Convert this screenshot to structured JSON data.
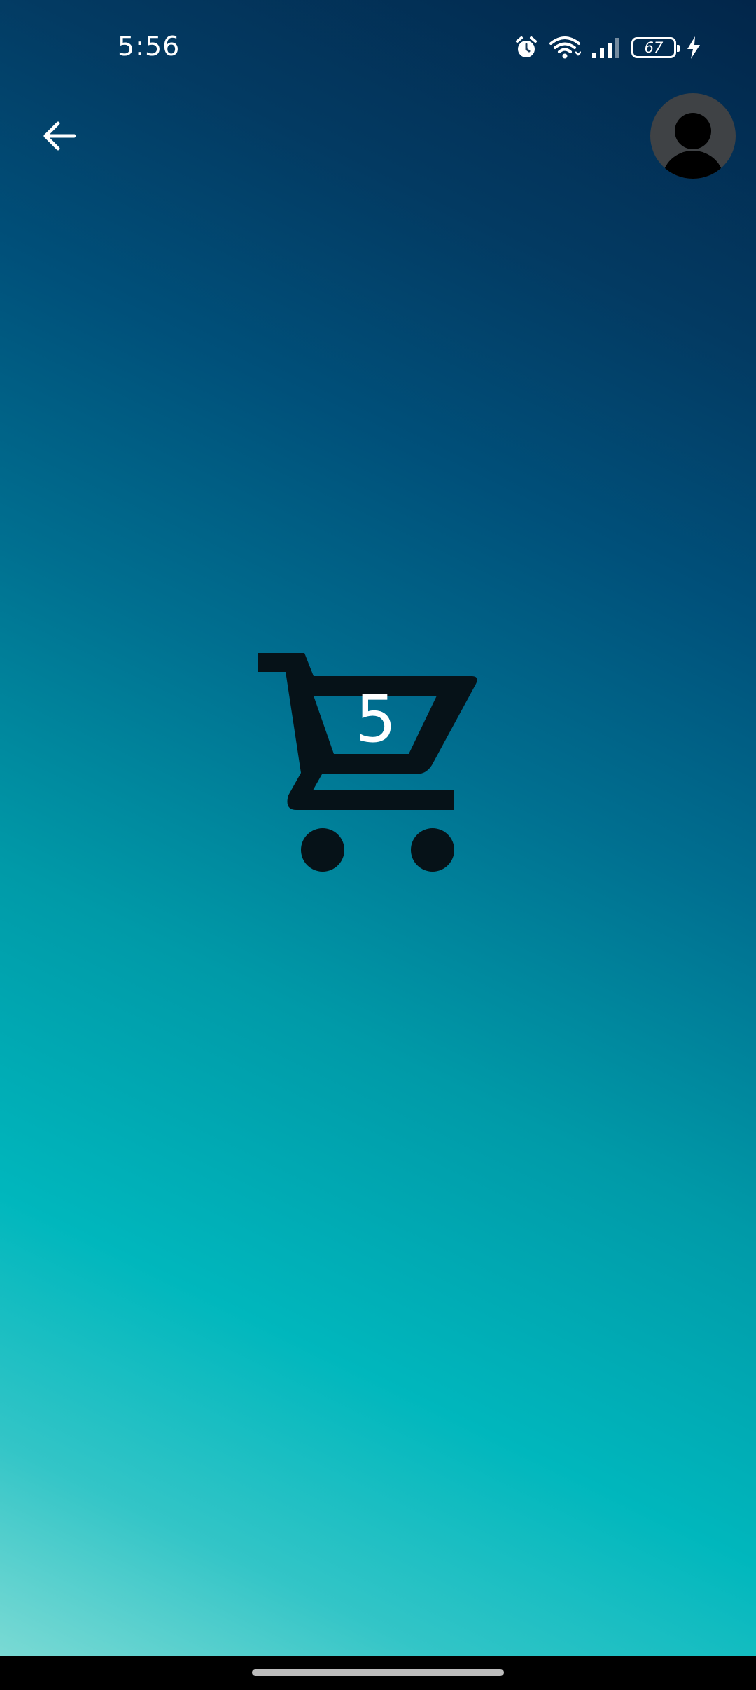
{
  "status_bar": {
    "time": "5:56",
    "battery_level": "67",
    "icons": [
      "alarm-icon",
      "wifi-icon",
      "signal-icon",
      "battery-icon",
      "charging-icon"
    ]
  },
  "app_bar": {
    "back_icon": "arrow-left-icon",
    "avatar_icon": "account-circle-icon"
  },
  "cart": {
    "icon": "shopping-cart-icon",
    "count": "5"
  },
  "colors": {
    "gradient_dark": "#02264a",
    "gradient_mid": "#006f90",
    "gradient_light": "#00b7bd",
    "gradient_corner": "#86ddd6",
    "cart_icon": "#061218",
    "text_on_dark": "#ffffff",
    "avatar_bg": "#3f4245"
  }
}
